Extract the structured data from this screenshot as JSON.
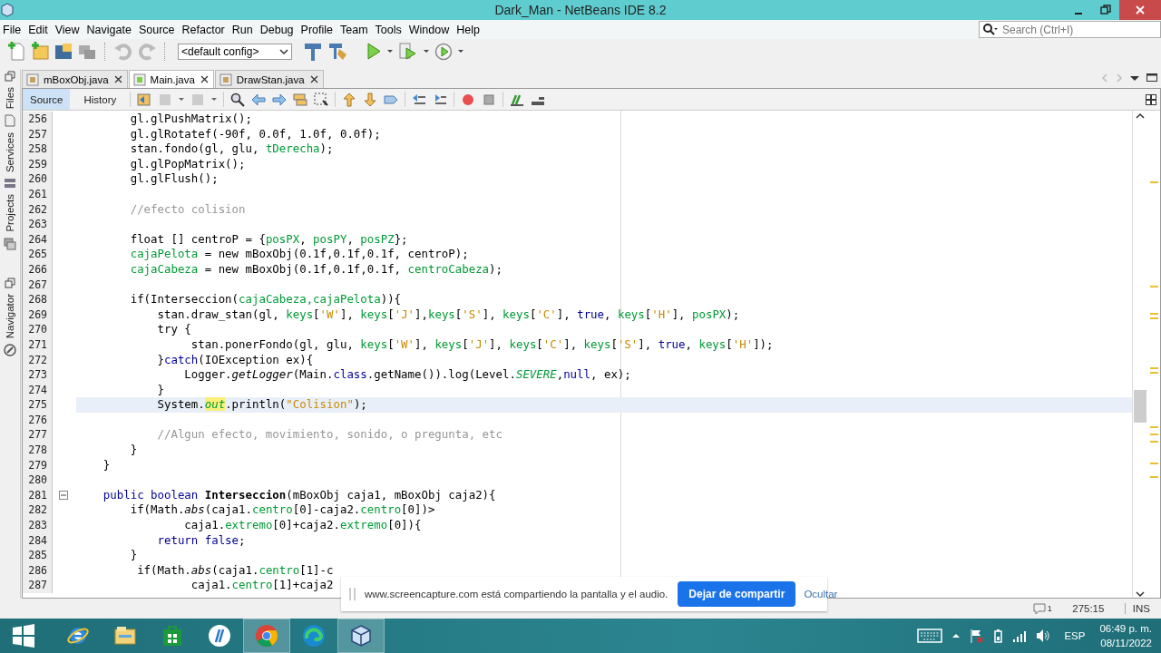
{
  "window": {
    "title": "Dark_Man - NetBeans IDE 8.2"
  },
  "menu": [
    "File",
    "Edit",
    "View",
    "Navigate",
    "Source",
    "Refactor",
    "Run",
    "Debug",
    "Profile",
    "Team",
    "Tools",
    "Window",
    "Help"
  ],
  "toolbar": {
    "config": "<default config>"
  },
  "search": {
    "placeholder": "Search (Ctrl+I)"
  },
  "side_tabs": [
    "Files",
    "Services",
    "Projects",
    "Navigator"
  ],
  "editor_tabs": [
    {
      "label": "mBoxObj.java",
      "selected": false
    },
    {
      "label": "Main.java",
      "selected": true
    },
    {
      "label": "DrawStan.java",
      "selected": false
    }
  ],
  "view_tabs": [
    {
      "label": "Source",
      "selected": true
    },
    {
      "label": "History",
      "selected": false
    }
  ],
  "code": [
    {
      "number": "256",
      "current": false,
      "fold": false,
      "tokens": [
        {
          "kind": "plain",
          "text": "        gl.glPushMatrix();"
        }
      ]
    },
    {
      "number": "257",
      "current": false,
      "fold": false,
      "tokens": [
        {
          "kind": "plain",
          "text": "        gl.glRotatef(-90f, 0.0f, 1.0f, 0.0f);"
        }
      ]
    },
    {
      "number": "258",
      "current": false,
      "fold": false,
      "tokens": [
        {
          "kind": "plain",
          "text": "        stan.fondo(gl, glu, "
        },
        {
          "kind": "field",
          "text": "tDerecha"
        },
        {
          "kind": "plain",
          "text": ");"
        }
      ]
    },
    {
      "number": "259",
      "current": false,
      "fold": false,
      "tokens": [
        {
          "kind": "plain",
          "text": "        gl.glPopMatrix();"
        }
      ]
    },
    {
      "number": "260",
      "current": false,
      "fold": false,
      "tokens": [
        {
          "kind": "plain",
          "text": "        gl.glFlush();"
        }
      ]
    },
    {
      "number": "261",
      "current": false,
      "fold": false
    },
    {
      "number": "262",
      "current": false,
      "fold": false,
      "tokens": [
        {
          "kind": "comment",
          "text": "        //efecto colision"
        }
      ]
    },
    {
      "number": "263",
      "current": false,
      "fold": false
    },
    {
      "number": "264",
      "current": false,
      "fold": false,
      "tokens": [
        {
          "kind": "plain",
          "text": "        float [] centroP = {"
        },
        {
          "kind": "field",
          "text": "posPX"
        },
        {
          "kind": "plain",
          "text": ", "
        },
        {
          "kind": "field",
          "text": "posPY"
        },
        {
          "kind": "plain",
          "text": ", "
        },
        {
          "kind": "field",
          "text": "posPZ"
        },
        {
          "kind": "plain",
          "text": "};"
        }
      ]
    },
    {
      "number": "265",
      "current": false,
      "fold": false,
      "tokens": [
        {
          "kind": "field",
          "text": "        cajaPelota"
        },
        {
          "kind": "plain",
          "text": " = new mBoxObj(0.1f,0.1f,0.1f, centroP);"
        }
      ]
    },
    {
      "number": "266",
      "current": false,
      "fold": false,
      "tokens": [
        {
          "kind": "field",
          "text": "        cajaCabeza"
        },
        {
          "kind": "plain",
          "text": " = new mBoxObj(0.1f,0.1f,0.1f, "
        },
        {
          "kind": "field",
          "text": "centroCabeza"
        },
        {
          "kind": "plain",
          "text": ");"
        }
      ]
    },
    {
      "number": "267",
      "current": false,
      "fold": false
    },
    {
      "number": "268",
      "current": false,
      "fold": false,
      "tokens": [
        {
          "kind": "plain",
          "text": "        if(Interseccion("
        },
        {
          "kind": "field",
          "text": "cajaCabeza,cajaPelota"
        },
        {
          "kind": "plain",
          "text": ")){"
        }
      ]
    },
    {
      "number": "269",
      "current": false,
      "fold": false,
      "tokens": [
        {
          "kind": "plain",
          "text": "            stan.draw_stan(gl, "
        },
        {
          "kind": "field",
          "text": "keys"
        },
        {
          "kind": "plain",
          "text": "["
        },
        {
          "kind": "string",
          "text": "'W'"
        },
        {
          "kind": "plain",
          "text": "], "
        },
        {
          "kind": "field",
          "text": "keys"
        },
        {
          "kind": "plain",
          "text": "["
        },
        {
          "kind": "string",
          "text": "'J'"
        },
        {
          "kind": "plain",
          "text": "],"
        },
        {
          "kind": "field",
          "text": "keys"
        },
        {
          "kind": "plain",
          "text": "["
        },
        {
          "kind": "string",
          "text": "'S'"
        },
        {
          "kind": "plain",
          "text": "], "
        },
        {
          "kind": "field",
          "text": "keys"
        },
        {
          "kind": "plain",
          "text": "["
        },
        {
          "kind": "string",
          "text": "'C'"
        },
        {
          "kind": "plain",
          "text": "], "
        },
        {
          "kind": "keyword",
          "text": "true"
        },
        {
          "kind": "plain",
          "text": ", "
        },
        {
          "kind": "field",
          "text": "keys"
        },
        {
          "kind": "plain",
          "text": "["
        },
        {
          "kind": "string",
          "text": "'H'"
        },
        {
          "kind": "plain",
          "text": "], "
        },
        {
          "kind": "field",
          "text": "posPX"
        },
        {
          "kind": "plain",
          "text": ");"
        }
      ]
    },
    {
      "number": "270",
      "current": false,
      "fold": false,
      "tokens": [
        {
          "kind": "plain",
          "text": "            try {"
        }
      ]
    },
    {
      "number": "271",
      "current": false,
      "fold": false,
      "tokens": [
        {
          "kind": "plain",
          "text": "                 stan.ponerFondo(gl, glu, "
        },
        {
          "kind": "field",
          "text": "keys"
        },
        {
          "kind": "plain",
          "text": "["
        },
        {
          "kind": "string",
          "text": "'W'"
        },
        {
          "kind": "plain",
          "text": "], "
        },
        {
          "kind": "field",
          "text": "keys"
        },
        {
          "kind": "plain",
          "text": "["
        },
        {
          "kind": "string",
          "text": "'J'"
        },
        {
          "kind": "plain",
          "text": "], "
        },
        {
          "kind": "field",
          "text": "keys"
        },
        {
          "kind": "plain",
          "text": "["
        },
        {
          "kind": "string",
          "text": "'C'"
        },
        {
          "kind": "plain",
          "text": "], "
        },
        {
          "kind": "field",
          "text": "keys"
        },
        {
          "kind": "plain",
          "text": "["
        },
        {
          "kind": "string",
          "text": "'S'"
        },
        {
          "kind": "plain",
          "text": "], "
        },
        {
          "kind": "keyword",
          "text": "true"
        },
        {
          "kind": "plain",
          "text": ", "
        },
        {
          "kind": "field",
          "text": "keys"
        },
        {
          "kind": "plain",
          "text": "["
        },
        {
          "kind": "string",
          "text": "'H'"
        },
        {
          "kind": "plain",
          "text": "]);"
        }
      ]
    },
    {
      "number": "272",
      "current": false,
      "fold": false,
      "tokens": [
        {
          "kind": "plain",
          "text": "            }"
        },
        {
          "kind": "keyword",
          "text": "catch"
        },
        {
          "kind": "plain",
          "text": "(IOException ex){"
        }
      ]
    },
    {
      "number": "273",
      "current": false,
      "fold": false,
      "tokens": [
        {
          "kind": "plain",
          "text": "                Logger."
        },
        {
          "kind": "static",
          "text": "getLogger"
        },
        {
          "kind": "plain",
          "text": "(Main."
        },
        {
          "kind": "keyword",
          "text": "class"
        },
        {
          "kind": "plain",
          "text": ".getName()).log(Level."
        },
        {
          "kind": "static_field",
          "text": "SEVERE"
        },
        {
          "kind": "plain",
          "text": ","
        },
        {
          "kind": "keyword",
          "text": "null"
        },
        {
          "kind": "plain",
          "text": ", ex);"
        }
      ]
    },
    {
      "number": "274",
      "current": false,
      "fold": false,
      "tokens": [
        {
          "kind": "plain",
          "text": "            }"
        }
      ]
    },
    {
      "number": "275",
      "current": true,
      "fold": false,
      "tokens": [
        {
          "kind": "plain",
          "text": "            System."
        },
        {
          "kind": "marked",
          "text": "out"
        },
        {
          "kind": "plain",
          "text": ".println("
        },
        {
          "kind": "string",
          "text": "\"Colision\""
        },
        {
          "kind": "plain",
          "text": ");"
        }
      ]
    },
    {
      "number": "276",
      "current": false,
      "fold": false
    },
    {
      "number": "277",
      "current": false,
      "fold": false,
      "tokens": [
        {
          "kind": "comment",
          "text": "            //Algun efecto, movimiento, sonido, o pregunta, etc"
        }
      ]
    },
    {
      "number": "278",
      "current": false,
      "fold": false,
      "tokens": [
        {
          "kind": "plain",
          "text": "        }"
        }
      ]
    },
    {
      "number": "279",
      "current": false,
      "fold": false,
      "tokens": [
        {
          "kind": "plain",
          "text": "    }"
        }
      ]
    },
    {
      "number": "280",
      "current": false,
      "fold": false
    },
    {
      "number": "281",
      "current": false,
      "fold": true,
      "tokens": [
        {
          "kind": "keyword",
          "text": "    public boolean "
        },
        {
          "kind": "bold",
          "text": "Interseccion"
        },
        {
          "kind": "plain",
          "text": "(mBoxObj caja1, mBoxObj caja2){"
        }
      ]
    },
    {
      "number": "282",
      "current": false,
      "fold": false,
      "tokens": [
        {
          "kind": "plain",
          "text": "        if(Math."
        },
        {
          "kind": "static",
          "text": "abs"
        },
        {
          "kind": "plain",
          "text": "(caja1."
        },
        {
          "kind": "field",
          "text": "centro"
        },
        {
          "kind": "plain",
          "text": "[0]-caja2."
        },
        {
          "kind": "field",
          "text": "centro"
        },
        {
          "kind": "plain",
          "text": "[0])>"
        }
      ]
    },
    {
      "number": "283",
      "current": false,
      "fold": false,
      "tokens": [
        {
          "kind": "plain",
          "text": "                caja1."
        },
        {
          "kind": "field",
          "text": "extremo"
        },
        {
          "kind": "plain",
          "text": "[0]+caja2."
        },
        {
          "kind": "field",
          "text": "extremo"
        },
        {
          "kind": "plain",
          "text": "[0]){"
        }
      ]
    },
    {
      "number": "284",
      "current": false,
      "fold": false,
      "tokens": [
        {
          "kind": "keyword",
          "text": "            return false"
        },
        {
          "kind": "plain",
          "text": ";"
        }
      ]
    },
    {
      "number": "285",
      "current": false,
      "fold": false,
      "tokens": [
        {
          "kind": "plain",
          "text": "        }"
        }
      ]
    },
    {
      "number": "286",
      "current": false,
      "fold": false,
      "tokens": [
        {
          "kind": "plain",
          "text": "         if(Math."
        },
        {
          "kind": "static",
          "text": "abs"
        },
        {
          "kind": "plain",
          "text": "(caja1."
        },
        {
          "kind": "field",
          "text": "centro"
        },
        {
          "kind": "plain",
          "text": "[1]-c"
        }
      ]
    },
    {
      "number": "287",
      "current": false,
      "fold": false,
      "tokens": [
        {
          "kind": "plain",
          "text": "                 caja1."
        },
        {
          "kind": "field",
          "text": "centro"
        },
        {
          "kind": "plain",
          "text": "[1]+caja2"
        }
      ]
    }
  ],
  "status_bar": {
    "notifications": "1",
    "position": "275:15",
    "mode": "INS"
  },
  "share_bar": {
    "message": "www.screencapture.com está compartiendo la pantalla y el audio.",
    "stop_button": "Dejar de compartir",
    "hide_link": "Ocultar"
  },
  "taskbar": {
    "apps": [
      {
        "kind": "ie",
        "selected": false
      },
      {
        "kind": "explorer",
        "selected": false
      },
      {
        "kind": "store",
        "selected": false
      },
      {
        "kind": "hp",
        "selected": false
      },
      {
        "kind": "chrome",
        "selected": true
      },
      {
        "kind": "edge",
        "selected": false
      },
      {
        "kind": "netbeans",
        "selected": true
      }
    ],
    "language": "ESP",
    "time": "06:49 p. m.",
    "date": "08/11/2022"
  }
}
